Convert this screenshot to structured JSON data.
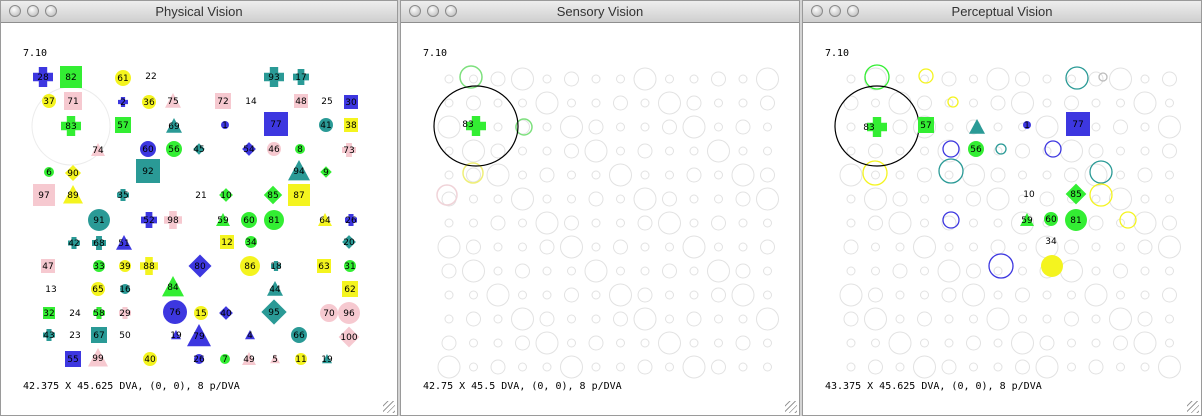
{
  "colors": {
    "green": "#33ee33",
    "blue": "#3d37e0",
    "teal": "#2a9a96",
    "yellow": "#f4f41f",
    "pink": "#f6c9d0"
  },
  "windows": [
    {
      "title": "Physical Vision",
      "corner_label": "7.10",
      "status": "42.375 X 45.625 DVA, (0, 0), 8 p/DVA",
      "objects": [
        {
          "label": "28",
          "shape": "cross",
          "color": "blue"
        },
        {
          "label": "82",
          "shape": "square",
          "color": "green"
        },
        {
          "label": "61",
          "shape": "circle",
          "color": "yellow"
        },
        {
          "label": "22"
        },
        {
          "label": "93",
          "shape": "cross",
          "color": "teal"
        },
        {
          "label": "17",
          "shape": "cross",
          "color": "teal"
        },
        {
          "label": "37",
          "shape": "circle",
          "color": "yellow"
        },
        {
          "label": "71",
          "shape": "square",
          "color": "pink"
        },
        {
          "label": "2",
          "shape": "cross",
          "color": "blue"
        },
        {
          "label": "36",
          "shape": "circle",
          "color": "yellow"
        },
        {
          "label": "75",
          "shape": "triangle",
          "color": "pink"
        },
        {
          "label": "72",
          "shape": "square",
          "color": "pink"
        },
        {
          "label": "14"
        },
        {
          "label": "48",
          "shape": "square",
          "color": "pink"
        },
        {
          "label": "25"
        },
        {
          "label": "30",
          "shape": "square",
          "color": "blue"
        },
        {
          "label": "83",
          "shape": "cross",
          "color": "green"
        },
        {
          "label": "57",
          "shape": "square",
          "color": "green"
        },
        {
          "label": "69",
          "shape": "triangle",
          "color": "teal"
        },
        {
          "label": "1",
          "shape": "circle",
          "color": "blue"
        },
        {
          "label": "77",
          "shape": "square",
          "color": "blue"
        },
        {
          "label": "41",
          "shape": "circle",
          "color": "teal"
        },
        {
          "label": "38",
          "shape": "square",
          "color": "yellow"
        },
        {
          "label": "74",
          "shape": "triangle",
          "color": "pink"
        },
        {
          "label": "60",
          "shape": "circle",
          "color": "blue"
        },
        {
          "label": "56",
          "shape": "circle",
          "color": "green"
        },
        {
          "label": "45",
          "shape": "diamond",
          "color": "teal"
        },
        {
          "label": "54",
          "shape": "diamond",
          "color": "blue"
        },
        {
          "label": "46",
          "shape": "circle",
          "color": "pink"
        },
        {
          "label": "8",
          "shape": "circle",
          "color": "green"
        },
        {
          "label": "73",
          "shape": "cross",
          "color": "pink"
        },
        {
          "label": "6",
          "shape": "circle",
          "color": "green"
        },
        {
          "label": "90",
          "shape": "diamond",
          "color": "yellow"
        },
        {
          "label": "92",
          "shape": "square",
          "color": "teal"
        },
        {
          "label": "94",
          "shape": "triangle",
          "color": "teal"
        },
        {
          "label": "9",
          "shape": "diamond",
          "color": "green"
        },
        {
          "label": "97",
          "shape": "square",
          "color": "pink"
        },
        {
          "label": "89",
          "shape": "triangle",
          "color": "yellow"
        },
        {
          "label": "35",
          "shape": "cross",
          "color": "teal"
        },
        {
          "label": "21"
        },
        {
          "label": "10",
          "shape": "diamond",
          "color": "green"
        },
        {
          "label": "85",
          "shape": "diamond",
          "color": "green"
        },
        {
          "label": "87",
          "shape": "square",
          "color": "yellow"
        },
        {
          "label": "91",
          "shape": "circle",
          "color": "teal"
        },
        {
          "label": "52",
          "shape": "cross",
          "color": "blue"
        },
        {
          "label": "98",
          "shape": "cross",
          "color": "pink"
        },
        {
          "label": "59",
          "shape": "triangle",
          "color": "green"
        },
        {
          "label": "60",
          "shape": "circle",
          "color": "green"
        },
        {
          "label": "81",
          "shape": "circle",
          "color": "green"
        },
        {
          "label": "64",
          "shape": "triangle",
          "color": "yellow"
        },
        {
          "label": "26",
          "shape": "cross",
          "color": "blue"
        },
        {
          "label": "42",
          "shape": "cross",
          "color": "teal"
        },
        {
          "label": "68",
          "shape": "cross",
          "color": "teal"
        },
        {
          "label": "51",
          "shape": "triangle",
          "color": "blue"
        },
        {
          "label": "12",
          "shape": "square",
          "color": "yellow"
        },
        {
          "label": "34",
          "shape": "circle",
          "color": "green"
        },
        {
          "label": "20",
          "shape": "diamond",
          "color": "teal"
        },
        {
          "label": "47",
          "shape": "square",
          "color": "pink"
        },
        {
          "label": "33",
          "shape": "circle",
          "color": "green"
        },
        {
          "label": "39",
          "shape": "circle",
          "color": "yellow"
        },
        {
          "label": "88",
          "shape": "cross",
          "color": "yellow"
        },
        {
          "label": "80",
          "shape": "diamond",
          "color": "blue"
        },
        {
          "label": "86",
          "shape": "circle",
          "color": "yellow"
        },
        {
          "label": "18",
          "shape": "cross",
          "color": "teal"
        },
        {
          "label": "63",
          "shape": "square",
          "color": "yellow"
        },
        {
          "label": "31",
          "shape": "circle",
          "color": "green"
        },
        {
          "label": "13"
        },
        {
          "label": "65",
          "shape": "circle",
          "color": "yellow"
        },
        {
          "label": "16",
          "shape": "circle",
          "color": "teal"
        },
        {
          "label": "84",
          "shape": "triangle",
          "color": "green"
        },
        {
          "label": "44",
          "shape": "triangle",
          "color": "teal"
        },
        {
          "label": "62",
          "shape": "square",
          "color": "yellow"
        },
        {
          "label": "32",
          "shape": "square",
          "color": "green"
        },
        {
          "label": "24"
        },
        {
          "label": "58",
          "shape": "cross",
          "color": "green"
        },
        {
          "label": "29",
          "shape": "cross",
          "color": "pink"
        },
        {
          "label": "76",
          "shape": "circle",
          "color": "blue"
        },
        {
          "label": "15",
          "shape": "circle",
          "color": "yellow"
        },
        {
          "label": "40",
          "shape": "diamond",
          "color": "blue"
        },
        {
          "label": "95",
          "shape": "diamond",
          "color": "teal"
        },
        {
          "label": "70",
          "shape": "circle",
          "color": "pink"
        },
        {
          "label": "96",
          "shape": "circle",
          "color": "pink"
        },
        {
          "label": "43",
          "shape": "cross",
          "color": "teal"
        },
        {
          "label": "23"
        },
        {
          "label": "67",
          "shape": "square",
          "color": "teal"
        },
        {
          "label": "50"
        },
        {
          "label": "19",
          "shape": "triangle",
          "color": "blue"
        },
        {
          "label": "79",
          "shape": "triangle",
          "color": "blue"
        },
        {
          "label": "4",
          "shape": "triangle",
          "color": "blue"
        },
        {
          "label": "66",
          "shape": "circle",
          "color": "teal"
        },
        {
          "label": "100",
          "shape": "diamond",
          "color": "pink"
        },
        {
          "label": "55",
          "shape": "square",
          "color": "blue"
        },
        {
          "label": "99",
          "shape": "triangle",
          "color": "pink"
        },
        {
          "label": "40",
          "shape": "circle",
          "color": "yellow"
        },
        {
          "label": "26",
          "shape": "circle",
          "color": "blue"
        },
        {
          "label": "7",
          "shape": "circle",
          "color": "green"
        },
        {
          "label": "49",
          "shape": "triangle",
          "color": "pink"
        },
        {
          "label": "5",
          "shape": "triangle",
          "color": "pink"
        },
        {
          "label": "11",
          "shape": "circle",
          "color": "yellow"
        },
        {
          "label": "19",
          "shape": "triangle",
          "color": "teal"
        }
      ]
    },
    {
      "title": "Sensory Vision",
      "corner_label": "7.10",
      "status": "42.75 X 45.5 DVA, (0, 0), 8 p/DVA",
      "focus_object": {
        "label": "83",
        "shape": "cross",
        "color": "green"
      }
    },
    {
      "title": "Perceptual Vision",
      "corner_label": "7.10",
      "status": "43.375 X 45.625 DVA, (0, 0), 8 p/DVA",
      "objects": [
        {
          "label": "83",
          "shape": "cross",
          "color": "green"
        },
        {
          "label": "57",
          "shape": "square",
          "color": "green"
        },
        {
          "label": "",
          "shape": "triangle",
          "color": "teal"
        },
        {
          "label": "1",
          "shape": "circle",
          "color": "blue"
        },
        {
          "label": "77",
          "shape": "square",
          "color": "blue"
        },
        {
          "label": "56",
          "shape": "circle",
          "color": "green"
        },
        {
          "label": "10"
        },
        {
          "label": "85",
          "shape": "diamond",
          "color": "green"
        },
        {
          "label": "59",
          "shape": "triangle",
          "color": "green"
        },
        {
          "label": "60",
          "shape": "circle",
          "color": "green"
        },
        {
          "label": "81",
          "shape": "circle",
          "color": "green"
        },
        {
          "label": "34"
        },
        {
          "label": "",
          "shape": "circle",
          "color": "yellow"
        }
      ]
    }
  ]
}
